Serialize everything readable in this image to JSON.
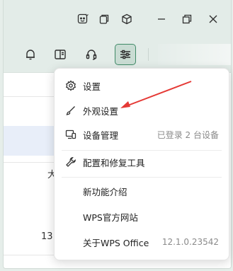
{
  "menu": {
    "items": [
      {
        "label": "设置",
        "icon": "gear-icon"
      },
      {
        "label": "外观设置",
        "icon": "brush-icon"
      },
      {
        "label": "设备管理",
        "icon": "device-icon",
        "right": "已登录 2 台设备"
      },
      {
        "label": "配置和修复工具",
        "icon": "wrench-icon"
      },
      {
        "label": "新功能介绍"
      },
      {
        "label": "WPS官方网站"
      },
      {
        "label": "关于WPS Office",
        "right": "12.1.0.23542"
      }
    ]
  },
  "background": {
    "fragment_1": "大",
    "fragment_2": "13"
  },
  "colors": {
    "accent": "#3f8a67",
    "annotation_arrow": "#e53935"
  }
}
